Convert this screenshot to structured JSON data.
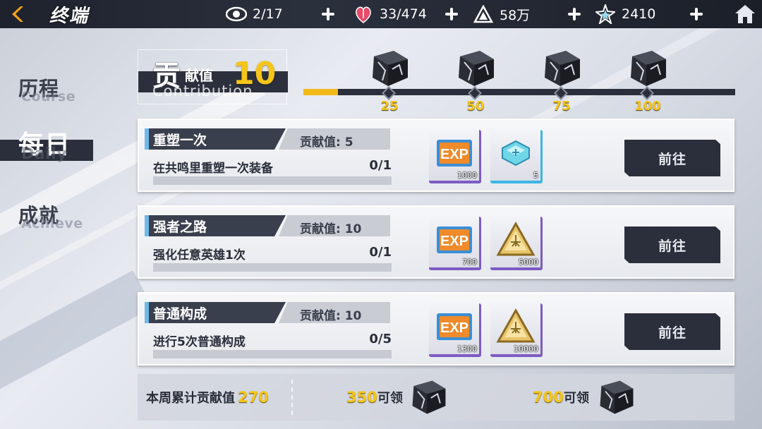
{
  "header": {
    "title": "终端",
    "resources": [
      {
        "icon": "eye-icon",
        "value": "2/17"
      },
      {
        "icon": "heart-icon",
        "value": "33/474"
      },
      {
        "icon": "triangle-chip-icon",
        "value": "58万"
      },
      {
        "icon": "star-crystal-icon",
        "value": "2410"
      }
    ]
  },
  "sidebar": {
    "items": [
      {
        "label": "历程",
        "sub": "Course",
        "active": false
      },
      {
        "label": "每日",
        "sub": "Daily",
        "active": true
      },
      {
        "label": "成就",
        "sub": "Achieve",
        "active": false
      }
    ]
  },
  "contribution": {
    "title_big": "贡",
    "title_rest": "献值",
    "title_en": "Contribution",
    "value": "10",
    "progress_fraction": 0.08,
    "milestones": [
      "25",
      "50",
      "75",
      "100"
    ]
  },
  "tasks": [
    {
      "name": "重塑一次",
      "points": "贡献值: 5",
      "desc": "在共鸣里重塑一次装备",
      "count": "0/1",
      "progress_fraction": 0,
      "rewards": [
        {
          "icon": "exp-icon",
          "qty": "1000",
          "rarity": "purple"
        },
        {
          "icon": "crystal-chip-icon",
          "qty": "5",
          "rarity": "cyan"
        }
      ],
      "go_label": "前往"
    },
    {
      "name": "强者之路",
      "points": "贡献值: 10",
      "desc": "强化任意英雄1次",
      "count": "0/1",
      "progress_fraction": 0,
      "rewards": [
        {
          "icon": "exp-icon",
          "qty": "700",
          "rarity": "purple"
        },
        {
          "icon": "gold-triangle-icon",
          "qty": "5000",
          "rarity": "purple"
        }
      ],
      "go_label": "前往"
    },
    {
      "name": "普通构成",
      "points": "贡献值: 10",
      "desc": "进行5次普通构成",
      "count": "0/5",
      "progress_fraction": 0,
      "rewards": [
        {
          "icon": "exp-icon",
          "qty": "1300",
          "rarity": "purple"
        },
        {
          "icon": "gold-triangle-icon",
          "qty": "10000",
          "rarity": "purple"
        }
      ],
      "go_label": "前往"
    }
  ],
  "footer": {
    "weekly_label": "本周累计贡献值",
    "weekly_value": "270",
    "goals": [
      {
        "value": "350",
        "label": "可领"
      },
      {
        "value": "700",
        "label": "可领"
      }
    ]
  },
  "colors": {
    "accent_gold": "#f5c518",
    "dark_panel": "#2b2f3b",
    "rarity_purple": "#7d5bc4",
    "rarity_cyan": "#3ab6e6"
  }
}
